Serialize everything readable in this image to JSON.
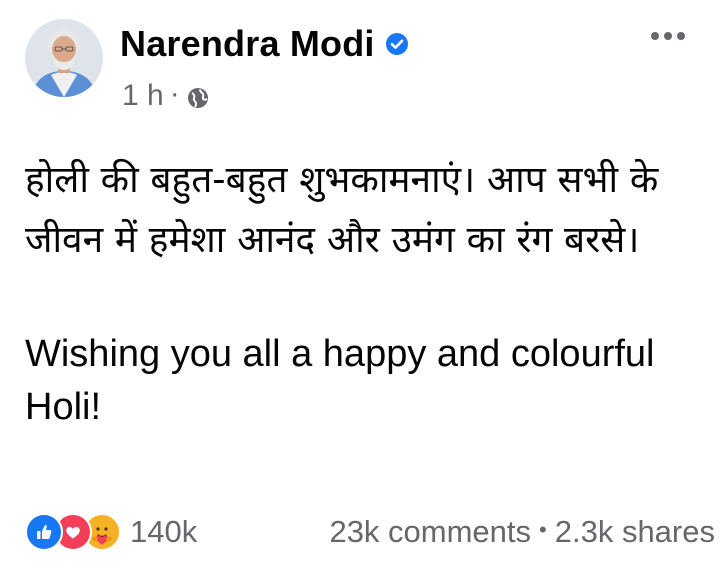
{
  "author": {
    "name": "Narendra Modi",
    "verified": true,
    "avatar_icon": "profile-photo"
  },
  "meta": {
    "time": "1 h",
    "separator": "·",
    "audience_icon": "globe-icon"
  },
  "actions": {
    "more_icon": "more-options-icon"
  },
  "post": {
    "hindi_text": "होली की बहुत-बहुत शुभकामनाएं। आप सभी के जीवन में हमेशा आनंद और उमंग का रंग बरसे।",
    "english_text": "Wishing you all a happy and colourful Holi!"
  },
  "stats": {
    "reactions": [
      "like-icon",
      "love-icon",
      "care-icon"
    ],
    "reaction_count": "140k",
    "comments": "23k comments",
    "separator": "•",
    "shares": "2.3k shares"
  },
  "colors": {
    "text_primary": "#050505",
    "text_secondary": "#65676b",
    "facebook_blue": "#1877f2",
    "love_red": "#f33e58",
    "care_yellow": "#f7b125"
  }
}
